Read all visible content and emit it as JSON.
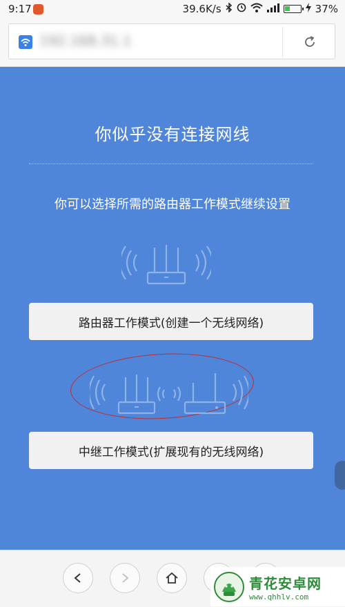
{
  "status_bar": {
    "time": "9:17",
    "network_speed": "39.6K/s",
    "battery_percent": "37%",
    "battery_level": 0.37,
    "icons": [
      "notification-icon",
      "bluetooth-icon",
      "alarm-icon",
      "wifi-icon",
      "signal-icon",
      "battery-icon",
      "charging-icon"
    ]
  },
  "address_bar": {
    "url_text": "192.168.31.1",
    "reload_icon": "reload-icon"
  },
  "page": {
    "title": "你似乎没有连接网线",
    "subtitle": "你可以选择所需的路由器工作模式继续设置",
    "router_mode_button": "路由器工作模式(创建一个无线网络)",
    "relay_mode_button": "中继工作模式(扩展现有的无线网络)"
  },
  "bottom_nav": {
    "buttons": [
      "back-icon",
      "forward-icon",
      "home-icon",
      "tabs-icon",
      "menu-icon"
    ]
  },
  "watermark": {
    "name": "青花安卓网",
    "url": "www.qhhlv.com"
  },
  "colors": {
    "page_background": "#4f86d9",
    "annotation_ellipse": "#c52a2a",
    "watermark_green": "#2e8b3a"
  }
}
